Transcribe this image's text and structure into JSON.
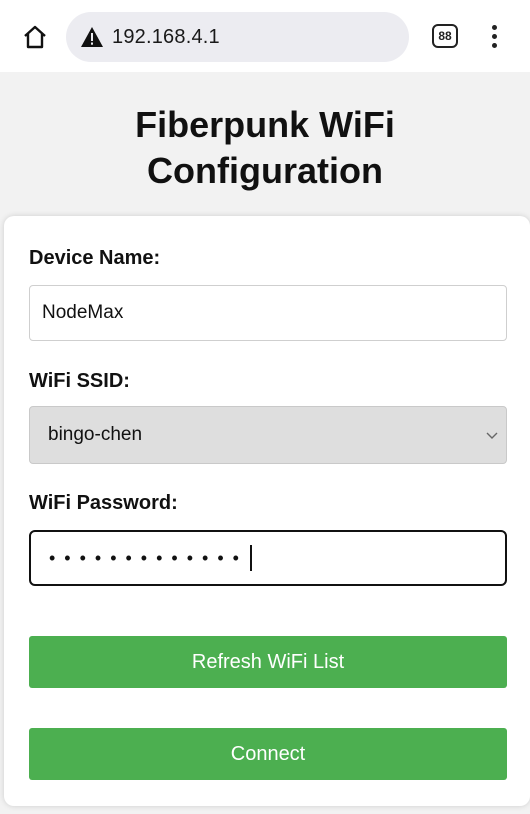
{
  "browser": {
    "url": "192.168.4.1",
    "tab_count": "88",
    "home_icon": "home-icon",
    "security_icon": "warning-triangle-icon",
    "menu_icon": "vertical-dots-icon"
  },
  "page": {
    "title_line1": "Fiberpunk WiFi",
    "title_line2": "Configuration"
  },
  "form": {
    "device_name_label": "Device Name:",
    "device_name_value": "NodeMax",
    "ssid_label": "WiFi SSID:",
    "ssid_selected": "bingo-chen",
    "password_label": "WiFi Password:",
    "password_masked": "•••••••••••••",
    "refresh_button": "Refresh WiFi List",
    "connect_button": "Connect"
  },
  "colors": {
    "button_green": "#4caf50",
    "page_bg": "#f2f2f2",
    "url_pill_bg": "#ececf1"
  }
}
